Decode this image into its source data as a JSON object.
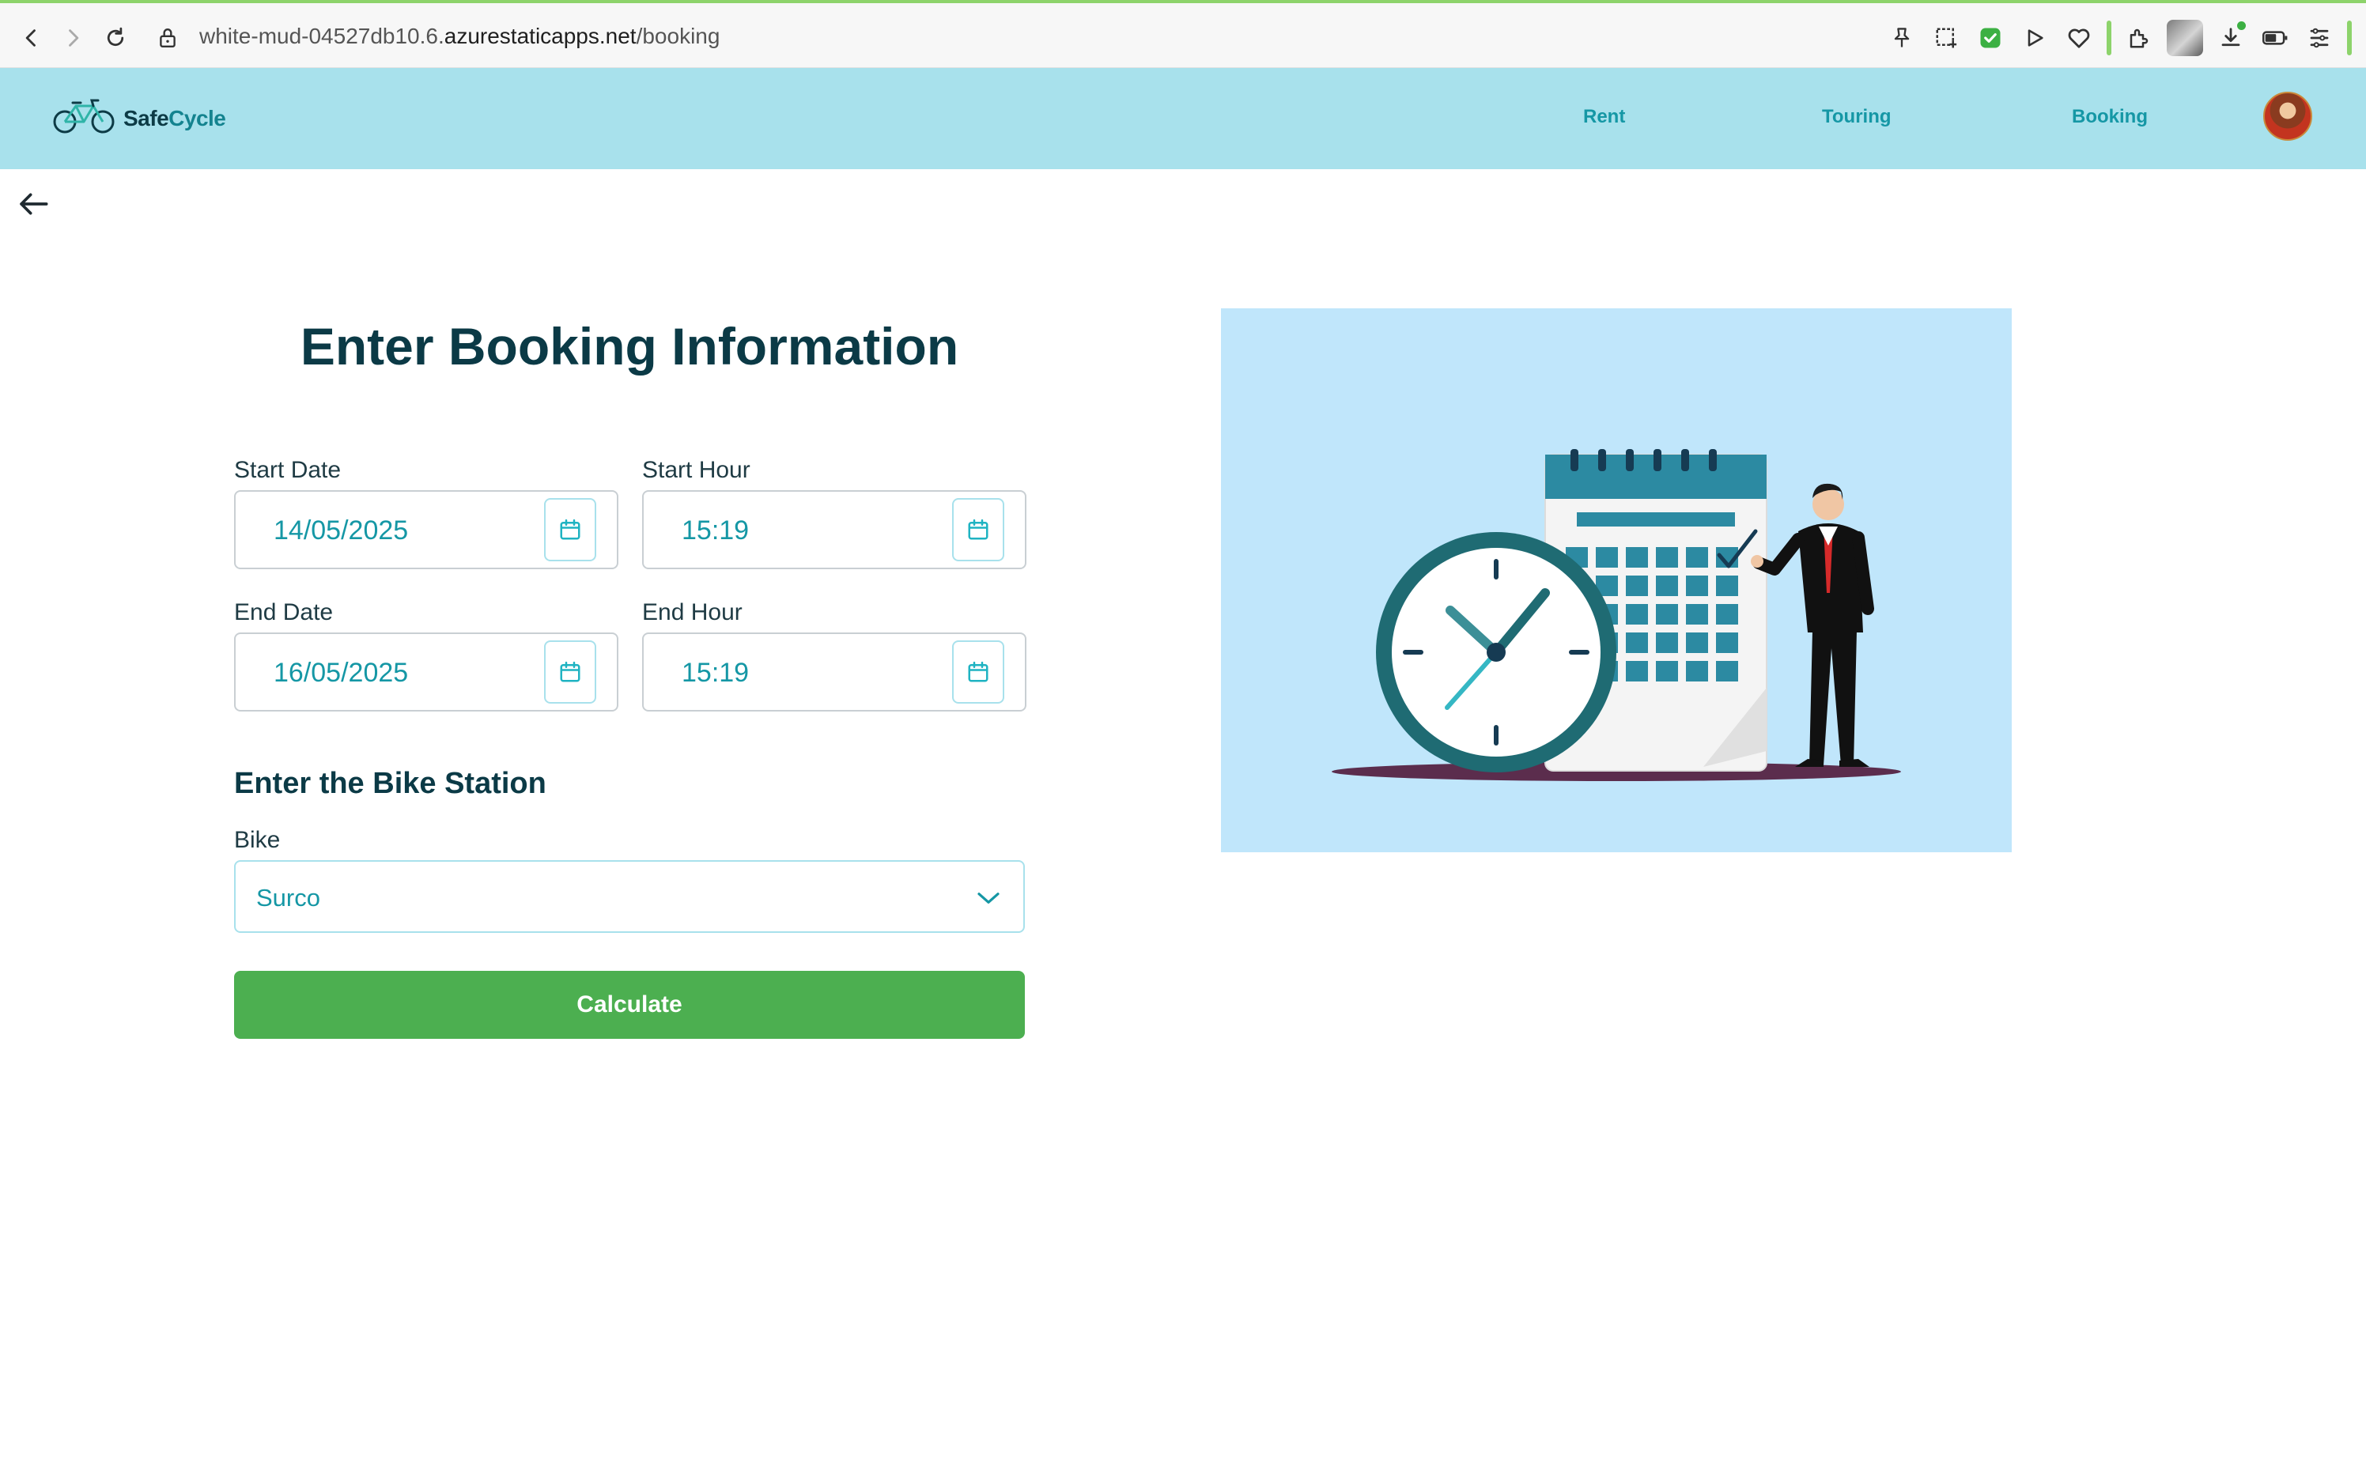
{
  "browser": {
    "url_path_prefix": "white-mud-04527db10.6.",
    "url_host": "azurestaticapps.net",
    "url_path": "/booking",
    "icons": [
      "back-icon",
      "forward-icon",
      "reload-icon",
      "lock-icon",
      "pin-icon",
      "screenshot-icon",
      "shield-icon",
      "play-icon",
      "heart-icon",
      "extensions-icon",
      "avatar",
      "download-icon",
      "battery-icon",
      "menu-icon"
    ]
  },
  "navbar": {
    "brand_prefix": "Safe",
    "brand_suffix": "Cycle",
    "links": [
      "Rent",
      "Touring",
      "Booking"
    ],
    "colors": {
      "bar": "#a8e1ec",
      "link": "#1597a5",
      "brand": "#0d3b46"
    }
  },
  "page": {
    "back_icon": "arrow-left-icon",
    "title": "Enter Booking Information",
    "start_date": {
      "label": "Start Date",
      "value": "14/05/2025"
    },
    "start_hour": {
      "label": "Start Hour",
      "value": "15:19"
    },
    "end_date": {
      "label": "End Date",
      "value": "16/05/2025"
    },
    "end_hour": {
      "label": "End Hour",
      "value": "15:19"
    },
    "picker_icon": "calendar-icon",
    "station_section_title": "Enter the Bike Station",
    "bike": {
      "label": "Bike",
      "value": "Surco",
      "icon": "chevron-down-icon"
    },
    "calculate_label": "Calculate",
    "colors": {
      "primary": "#4caf50",
      "accent": "#1597a5",
      "heading": "#0b3a46",
      "illustration_bg": "#c0e6fb"
    }
  }
}
